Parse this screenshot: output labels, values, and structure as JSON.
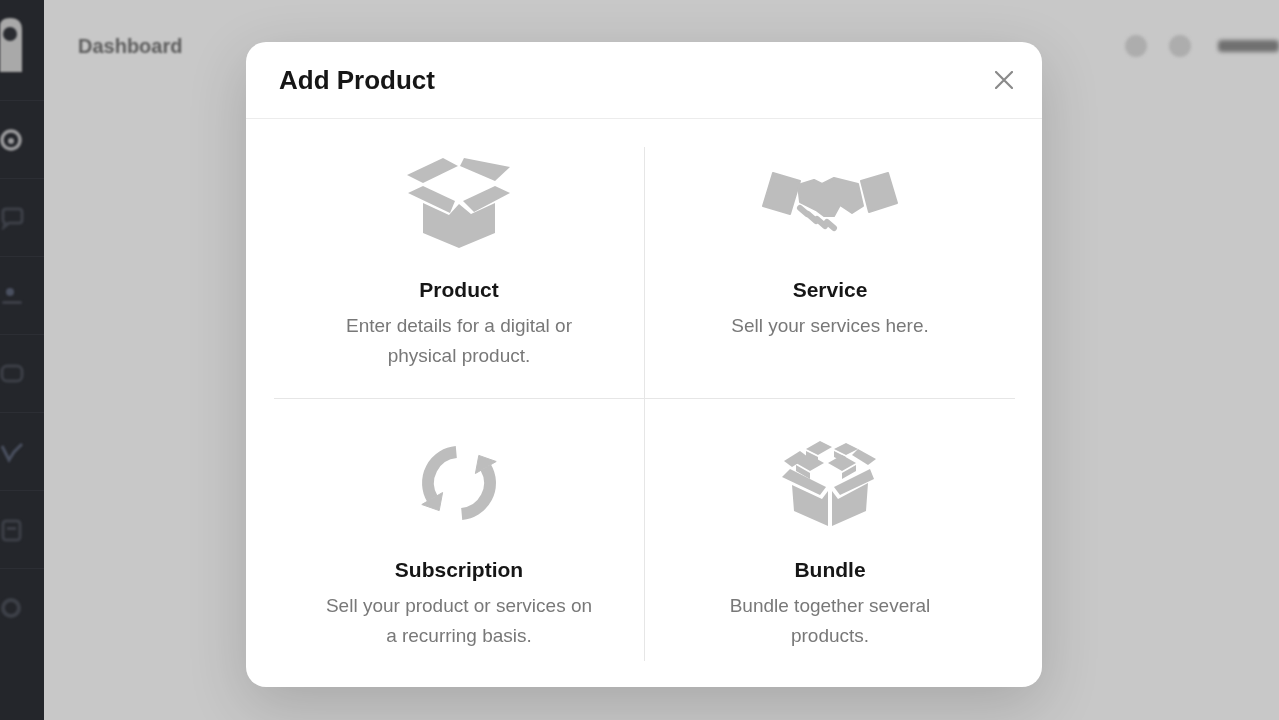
{
  "page": {
    "title": "Dashboard"
  },
  "dialog": {
    "title": "Add Product",
    "options": [
      {
        "kind": "box",
        "title": "Product",
        "description": "Enter details for a digital or physical product."
      },
      {
        "kind": "handshake",
        "title": "Service",
        "description": "Sell your services here."
      },
      {
        "kind": "cycle",
        "title": "Subscription",
        "description": "Sell your product or services on a recurring basis."
      },
      {
        "kind": "boxes",
        "title": "Bundle",
        "description": "Bundle together several products."
      }
    ]
  }
}
